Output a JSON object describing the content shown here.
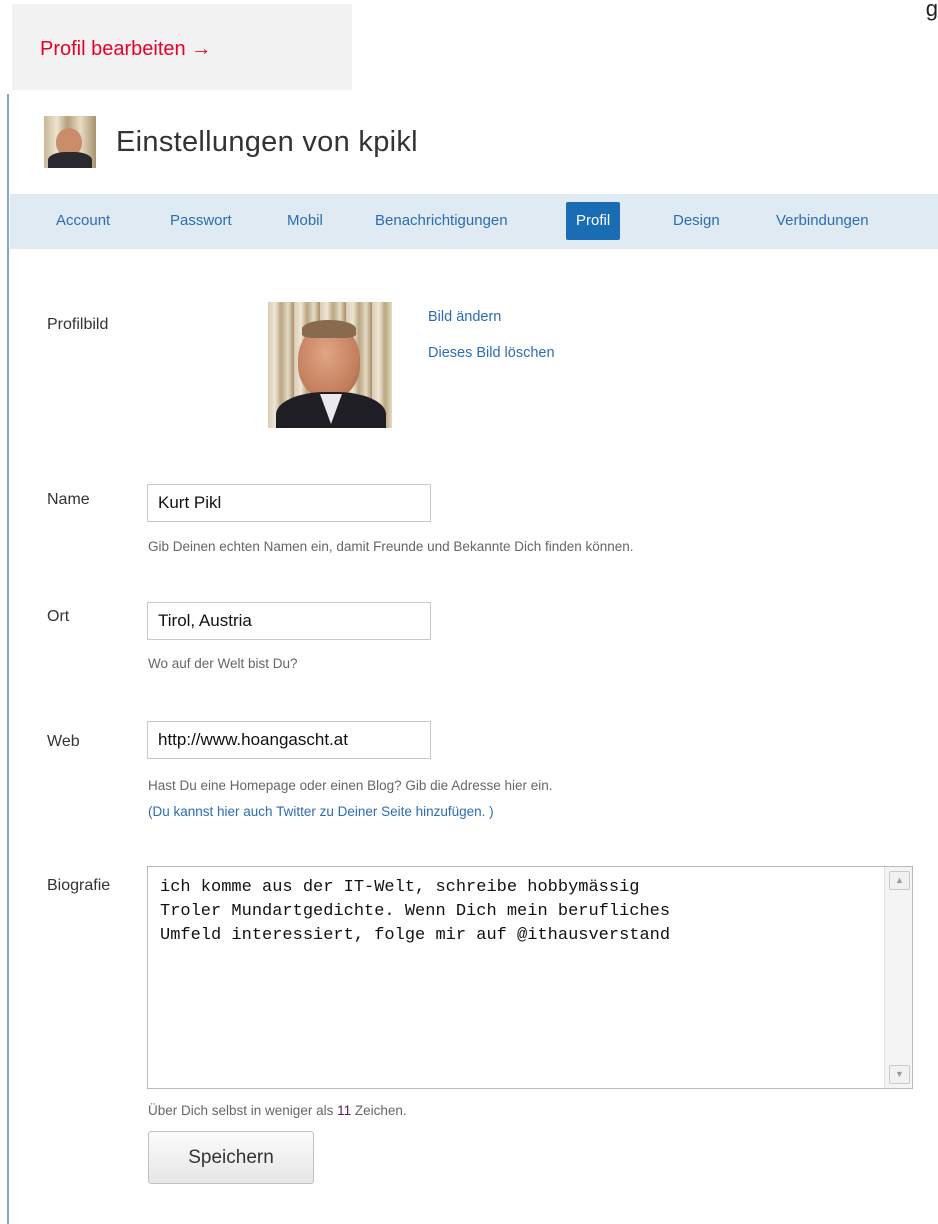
{
  "corner_text": "g",
  "banner": {
    "edit_profile": "Profil bearbeiten →"
  },
  "header": {
    "title": "Einstellungen von kpikl"
  },
  "tabs": [
    {
      "label": "Account"
    },
    {
      "label": "Passwort"
    },
    {
      "label": "Mobil"
    },
    {
      "label": "Benachrichtigungen"
    },
    {
      "label": "Profil",
      "active": true
    },
    {
      "label": "Design"
    },
    {
      "label": "Verbindungen"
    }
  ],
  "profile_picture": {
    "label": "Profilbild",
    "change_link": "Bild ändern",
    "delete_link": "Dieses Bild löschen"
  },
  "name": {
    "label": "Name",
    "value": "Kurt Pikl",
    "hint": "Gib Deinen echten Namen ein, damit Freunde und Bekannte Dich finden können."
  },
  "location": {
    "label": "Ort",
    "value": "Tirol, Austria",
    "hint": "Wo auf der Welt bist Du?"
  },
  "web": {
    "label": "Web",
    "value": "http://www.hoangascht.at",
    "hint": "Hast Du eine Homepage oder einen Blog? Gib die Adresse hier ein.",
    "twitter_link": "(Du kannst hier auch Twitter zu Deiner Seite hinzufügen. )"
  },
  "bio": {
    "label": "Biografie",
    "value": "ich komme aus der IT-Welt, schreibe hobbymässig\nTroler Mundartgedichte. Wenn Dich mein berufliches\nUmfeld interessiert, folge mir auf @ithausverstand",
    "hint_before": "Über Dich selbst in weniger als ",
    "remaining": "11",
    "hint_after": " Zeichen."
  },
  "save_button": "Speichern",
  "colors": {
    "accent": "#1a6cb5",
    "link": "#2a6db3",
    "banner_text": "#e8002a",
    "tab_bar": "#e0eaf3",
    "counter": "#5a1c5a"
  }
}
